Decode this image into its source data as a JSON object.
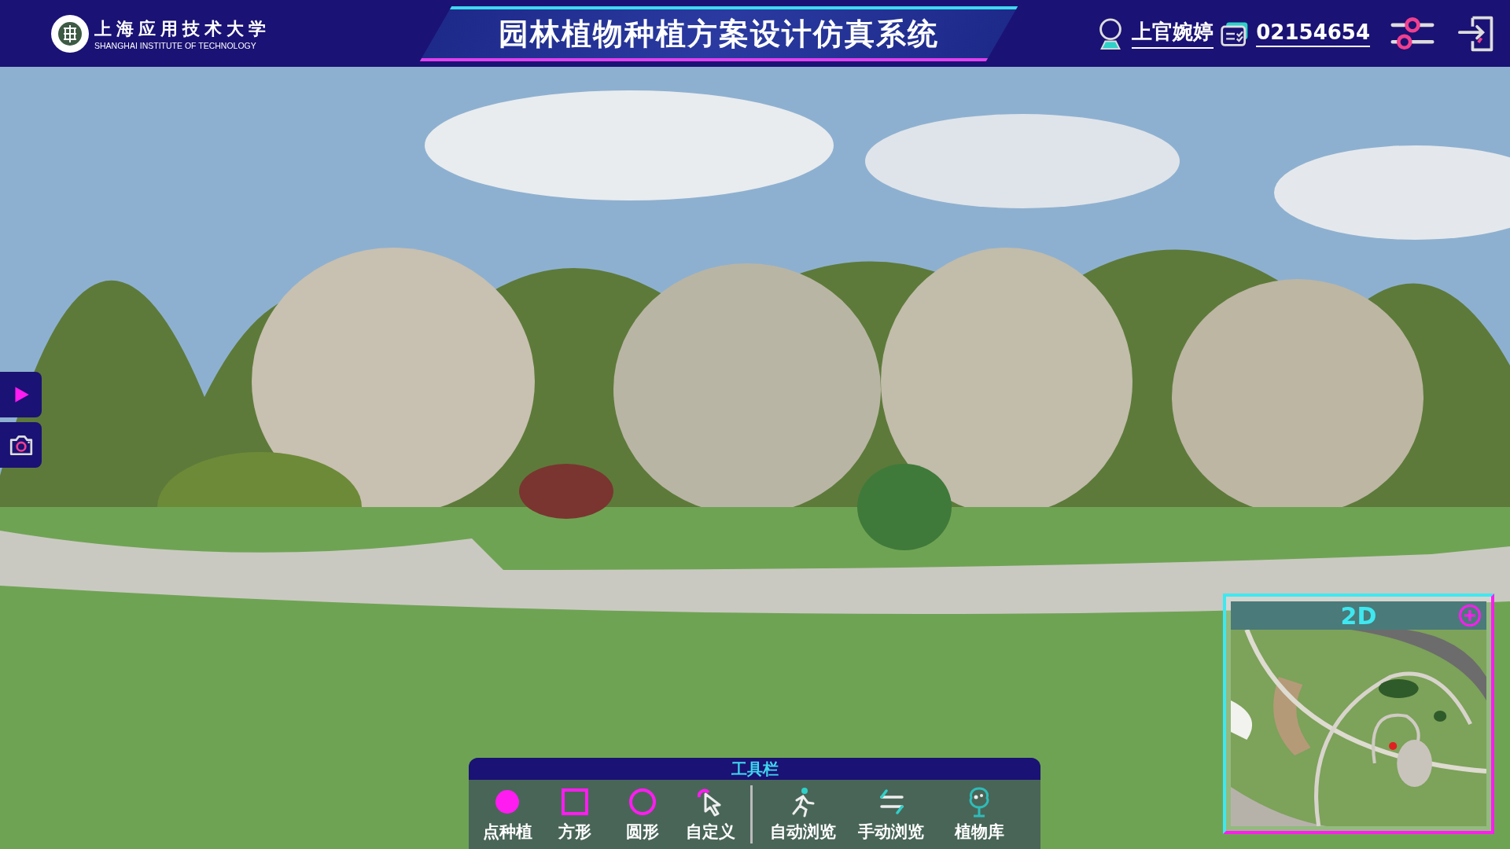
{
  "header": {
    "school_name": "上海应用技术大学",
    "school_name_en": "SHANGHAI INSTITUTE OF TECHNOLOGY",
    "title": "园林植物种植方案设计仿真系统",
    "user_name": "上官婉婷",
    "student_id": "02154654"
  },
  "side_buttons": [
    {
      "kind": "play"
    },
    {
      "kind": "camera"
    }
  ],
  "minimap": {
    "mode": "2D"
  },
  "toolbar": {
    "title": "工具栏",
    "drawing_tools": [
      {
        "kind": "point",
        "label": "点种植"
      },
      {
        "kind": "square",
        "label": "方形"
      },
      {
        "kind": "circle",
        "label": "圆形"
      },
      {
        "kind": "custom",
        "label": "自定义"
      }
    ],
    "browse_tools": [
      {
        "kind": "walk",
        "label": "自动浏览"
      },
      {
        "kind": "swap",
        "label": "手动浏览"
      },
      {
        "kind": "tree",
        "label": "植物库"
      }
    ]
  }
}
